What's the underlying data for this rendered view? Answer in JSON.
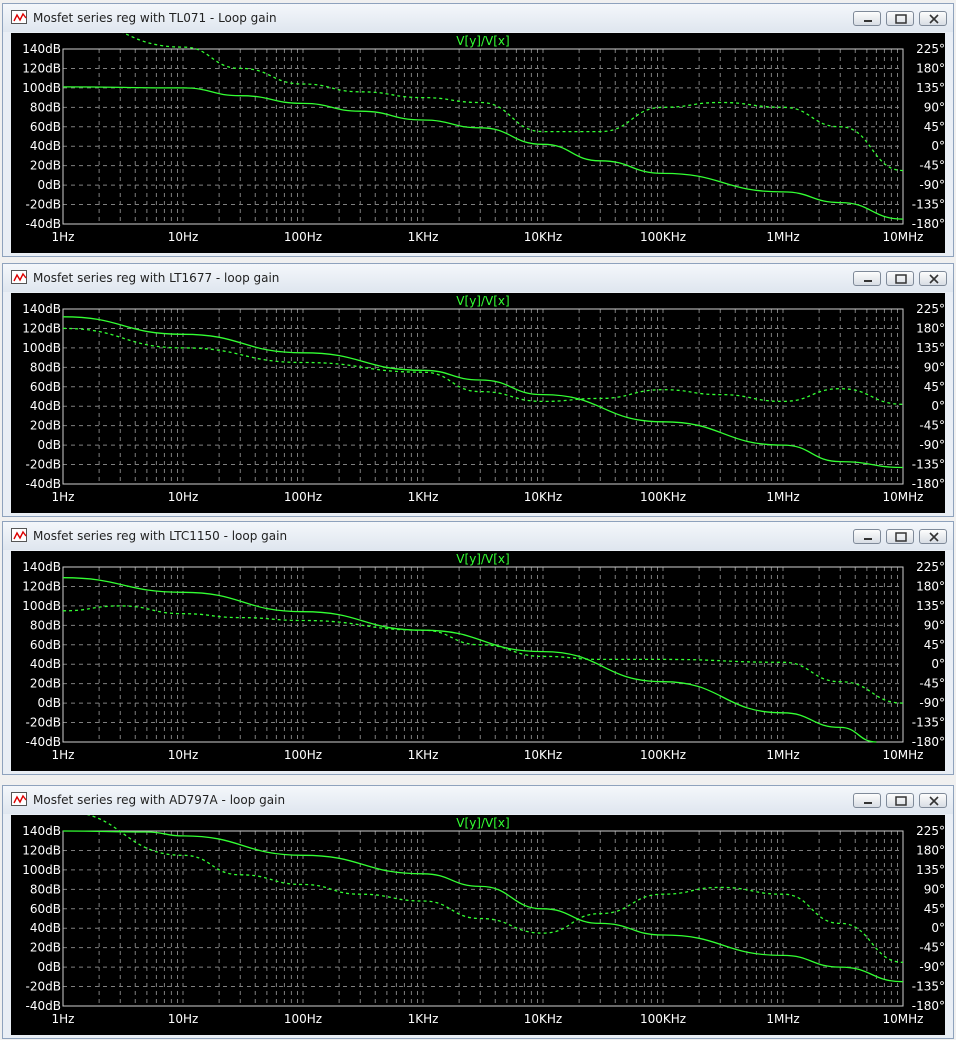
{
  "windows": [
    {
      "title": "Mosfet series reg with TL071 - Loop gain",
      "expression": "V[y]/V[x]",
      "chart_data": {
        "type": "line",
        "x_scale": "log",
        "xlim": [
          1,
          10000000
        ],
        "xticks": [
          "1Hz",
          "10Hz",
          "100Hz",
          "1KHz",
          "10KHz",
          "100KHz",
          "1MHz",
          "10MHz"
        ],
        "ylim_db": [
          -40,
          140
        ],
        "yticks_left": [
          "140dB",
          "120dB",
          "100dB",
          "80dB",
          "60dB",
          "40dB",
          "20dB",
          "0dB",
          "-20dB",
          "-40dB"
        ],
        "ylim_deg": [
          -180,
          225
        ],
        "yticks_right": [
          "225°",
          "180°",
          "135°",
          "90°",
          "45°",
          "0°",
          "-45°",
          "-90°",
          "-135°",
          "-180°"
        ],
        "series": [
          {
            "style": "solid",
            "x": [
              1,
              10,
              30,
              100,
              300,
              1000,
              3000,
              10000,
              30000,
              100000,
              1000000,
              3000000,
              10000000
            ],
            "y": [
              101,
              100,
              92,
              84,
              76,
              67,
              59,
              42,
              25,
              12,
              -7,
              -18,
              -35
            ]
          },
          {
            "style": "dashed",
            "x": [
              1,
              10,
              30,
              100,
              300,
              1000,
              3000,
              10000,
              30000,
              100000,
              300000,
              1000000,
              3000000,
              10000000
            ],
            "y": [
              172,
              142,
              120,
              104,
              96,
              90,
              85,
              55,
              55,
              80,
              85,
              80,
              60,
              15
            ]
          }
        ]
      }
    },
    {
      "title": "Mosfet series reg with LT1677 - loop gain",
      "expression": "V[y]/V[x]",
      "chart_data": {
        "type": "line",
        "x_scale": "log",
        "xlim": [
          1,
          10000000
        ],
        "xticks": [
          "1Hz",
          "10Hz",
          "100Hz",
          "1KHz",
          "10KHz",
          "100KHz",
          "1MHz",
          "10MHz"
        ],
        "ylim_db": [
          -40,
          140
        ],
        "yticks_left": [
          "140dB",
          "120dB",
          "100dB",
          "80dB",
          "60dB",
          "40dB",
          "20dB",
          "0dB",
          "-20dB",
          "-40dB"
        ],
        "ylim_deg": [
          -180,
          225
        ],
        "yticks_right": [
          "225°",
          "180°",
          "135°",
          "90°",
          "45°",
          "0°",
          "-45°",
          "-90°",
          "-135°",
          "-180°"
        ],
        "series": [
          {
            "style": "solid",
            "x": [
              1,
              10,
              100,
              1000,
              3000,
              10000,
              100000,
              1000000,
              3000000,
              10000000
            ],
            "y": [
              132,
              114,
              95,
              77,
              67,
              52,
              24,
              0,
              -17,
              -23
            ]
          },
          {
            "style": "dashed",
            "x": [
              1,
              10,
              100,
              1000,
              3000,
              10000,
              30000,
              100000,
              300000,
              1000000,
              3000000,
              10000000
            ],
            "y": [
              120,
              100,
              85,
              75,
              55,
              45,
              48,
              57,
              52,
              45,
              58,
              42
            ]
          }
        ]
      }
    },
    {
      "title": "Mosfet series reg with LTC1150 - loop gain",
      "expression": "V[y]/V[x]",
      "chart_data": {
        "type": "line",
        "x_scale": "log",
        "xlim": [
          1,
          10000000
        ],
        "xticks": [
          "1Hz",
          "10Hz",
          "100Hz",
          "1KHz",
          "10KHz",
          "100KHz",
          "1MHz",
          "10MHz"
        ],
        "ylim_db": [
          -40,
          140
        ],
        "yticks_left": [
          "140dB",
          "120dB",
          "100dB",
          "80dB",
          "60dB",
          "40dB",
          "20dB",
          "0dB",
          "-20dB",
          "-40dB"
        ],
        "ylim_deg": [
          -180,
          225
        ],
        "yticks_right": [
          "225°",
          "180°",
          "135°",
          "90°",
          "45°",
          "0°",
          "-45°",
          "-90°",
          "-135°",
          "-180°"
        ],
        "series": [
          {
            "style": "solid",
            "x": [
              1,
              10,
              100,
              1000,
              10000,
              100000,
              1000000,
              3000000,
              6000000
            ],
            "y": [
              129,
              114,
              94,
              75,
              53,
              22,
              -10,
              -25,
              -40
            ]
          },
          {
            "style": "dashed",
            "x": [
              1,
              3,
              10,
              30,
              100,
              1000,
              3000,
              10000,
              30000,
              100000,
              1000000,
              3000000,
              10000000
            ],
            "y": [
              95,
              100,
              92,
              88,
              85,
              75,
              60,
              48,
              45,
              45,
              42,
              22,
              0
            ]
          }
        ]
      }
    },
    {
      "title": "Mosfet series reg with AD797A - loop gain",
      "expression": "V[y]/V[x]",
      "chart_data": {
        "type": "line",
        "x_scale": "log",
        "xlim": [
          1,
          10000000
        ],
        "xticks": [
          "1Hz",
          "10Hz",
          "100Hz",
          "1KHz",
          "10KHz",
          "100KHz",
          "1MHz",
          "10MHz"
        ],
        "ylim_db": [
          -40,
          140
        ],
        "yticks_left": [
          "140dB",
          "120dB",
          "100dB",
          "80dB",
          "60dB",
          "40dB",
          "20dB",
          "0dB",
          "-20dB",
          "-40dB"
        ],
        "ylim_deg": [
          -180,
          225
        ],
        "yticks_right": [
          "225°",
          "180°",
          "135°",
          "90°",
          "45°",
          "0°",
          "-45°",
          "-90°",
          "-135°",
          "-180°"
        ],
        "series": [
          {
            "style": "solid",
            "x": [
              1,
              5,
              10,
              100,
              1000,
              3000,
              10000,
              30000,
              100000,
              1000000,
              3000000,
              10000000
            ],
            "y": [
              140,
              139,
              135,
              115,
              96,
              83,
              60,
              45,
              33,
              12,
              0,
              -15
            ]
          },
          {
            "style": "dashed",
            "x": [
              1,
              10,
              30,
              100,
              300,
              1000,
              3000,
              10000,
              30000,
              100000,
              300000,
              1000000,
              3000000,
              10000000
            ],
            "y": [
              160,
              115,
              95,
              85,
              75,
              68,
              50,
              35,
              55,
              75,
              82,
              75,
              45,
              5
            ]
          }
        ]
      }
    }
  ],
  "colors": {
    "plot_bg": "#000000",
    "trace": "#33ff33",
    "axis_text": "#ffffff",
    "grid": "#7f7f7f"
  },
  "icons": {
    "app": "waveform-icon",
    "minimize": "minimize-icon",
    "restore": "restore-icon",
    "close": "close-icon"
  }
}
